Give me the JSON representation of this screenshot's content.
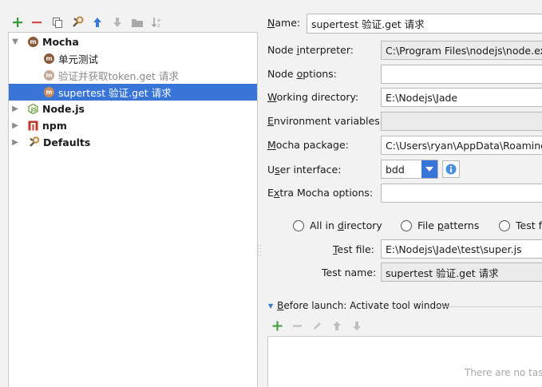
{
  "toolbar": {
    "icons": [
      "add-icon",
      "remove-icon",
      "copy-icon",
      "wrench-icon",
      "move-up-icon",
      "move-down-icon",
      "folder-icon",
      "sort-icon"
    ],
    "colors": {
      "add": "#3a9a3a",
      "remove": "#d54a4a",
      "move_up": "#3a7bd5"
    }
  },
  "tree": {
    "mocha": {
      "label": "Mocha",
      "icon": "m"
    },
    "mocha_children": [
      {
        "label": "单元测试",
        "icon": "m"
      },
      {
        "label": "验证并获取token.get 请求",
        "icon": "m"
      },
      {
        "label": "supertest 验证.get 请求",
        "icon": "m"
      }
    ],
    "nodejs": {
      "label": "Node.js"
    },
    "npm": {
      "label": "npm"
    },
    "defaults": {
      "label": "Defaults"
    }
  },
  "form": {
    "name_label_u": "N",
    "name_label_rest": "ame:",
    "name_value": "supertest 验证.get 请求",
    "interpreter_label_pre": "Node ",
    "interpreter_label_u": "i",
    "interpreter_label_rest": "nterpreter:",
    "interpreter_value": "C:\\Program Files\\nodejs\\node.exe",
    "options_label_pre": "Node ",
    "options_label_u": "o",
    "options_label_rest": "ptions:",
    "options_value": "",
    "workdir_label_u": "W",
    "workdir_label_rest": "orking directory:",
    "workdir_value": "E:\\Nodejs\\Jade",
    "env_label_u": "E",
    "env_label_rest": "nvironment variables:",
    "env_value": "",
    "mocha_pkg_label_u": "M",
    "mocha_pkg_label_rest": "ocha package:",
    "mocha_pkg_value": "C:\\Users\\ryan\\AppData\\Roaming\\",
    "ui_label_pre": "U",
    "ui_label_u": "s",
    "ui_label_rest": "er interface:",
    "ui_value": "bdd",
    "extra_label_pre": "E",
    "extra_label_u": "x",
    "extra_label_rest": "tra Mocha options:",
    "extra_value": ""
  },
  "scope": {
    "all_pre": "All in ",
    "all_u": "d",
    "all_rest": "irectory",
    "patterns_pre": "File ",
    "patterns_u": "p",
    "patterns_rest": "atterns",
    "test_label": "Test f",
    "test_file_pre": "",
    "test_file_u": "T",
    "test_file_rest": "est file:",
    "test_file_value": "E:\\Nodejs\\Jade\\test\\super.js",
    "test_name_label": "Test name:",
    "test_name_value": "supertest 验证.get 请求"
  },
  "before_launch": {
    "label_u": "B",
    "label_rest": "efore launch: Activate tool window",
    "empty_text": "There are no tas"
  }
}
